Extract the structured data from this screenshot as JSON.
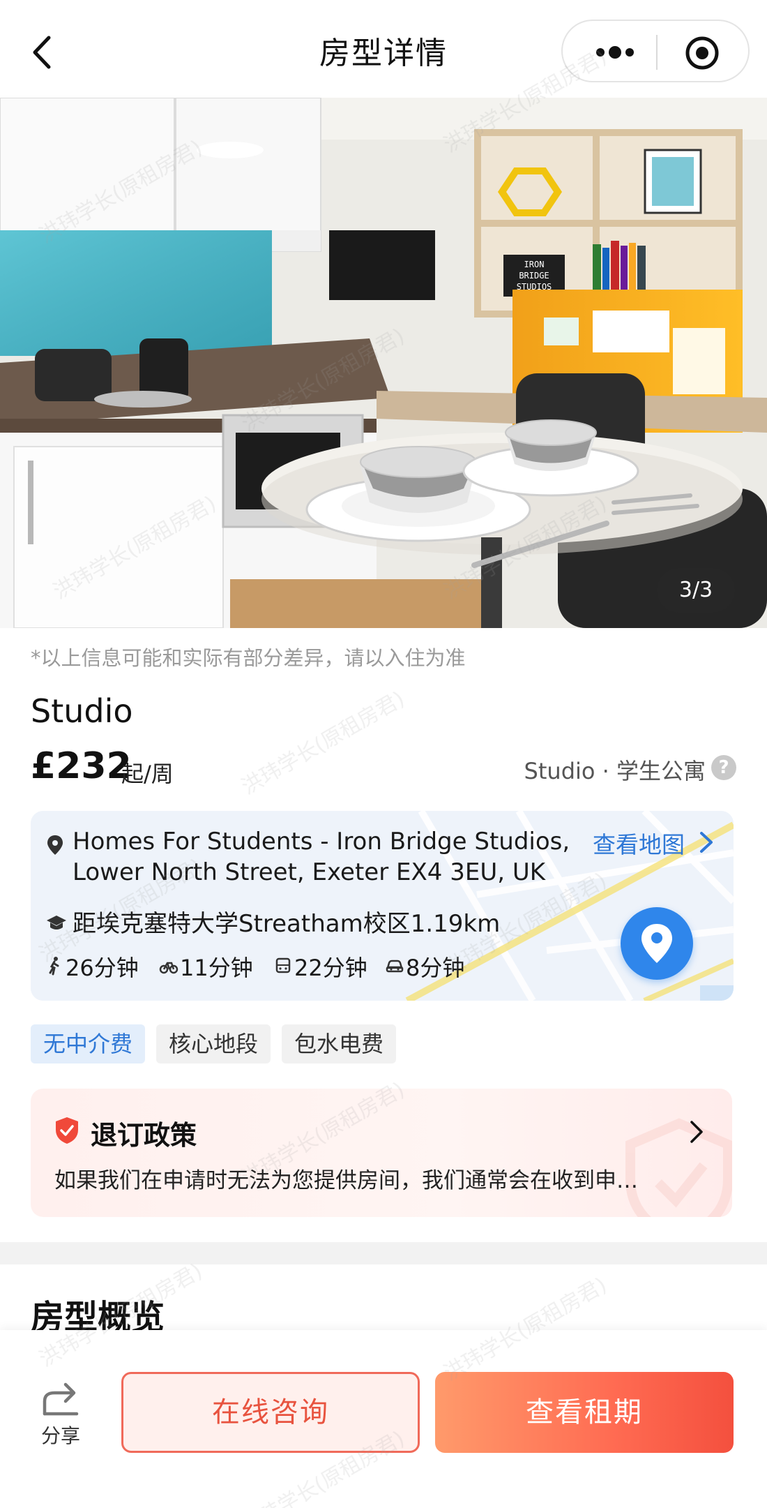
{
  "nav": {
    "title": "房型详情"
  },
  "hero": {
    "counter": "3/3",
    "sign_text": [
      "IRON",
      "BRIDGE",
      "STUDIOS"
    ]
  },
  "info": {
    "disclaimer": "*以上信息可能和实际有部分差异，请以入住为准",
    "room_name": "Studio",
    "price": "£232",
    "price_unit": "起/周",
    "room_type": "Studio · 学生公寓",
    "help_icon": "?"
  },
  "location": {
    "address": "Homes For Students - Iron Bridge Studios, Lower North Street, Exeter EX4 3EU, UK",
    "view_map_label": "查看地图",
    "distance": "距埃克塞特大学Streatham校区1.19km",
    "walk": "26分钟",
    "bike": "11分钟",
    "bus": "22分钟",
    "car": "8分钟"
  },
  "tags": [
    "无中介费",
    "核心地段",
    "包水电费"
  ],
  "policy": {
    "title": "退订政策",
    "description": "如果我们在申请时无法为您提供房间，我们通常会在收到申…"
  },
  "overview": {
    "title": "房型概览"
  },
  "bottom_bar": {
    "share_label": "分享",
    "consult_label": "在线咨询",
    "lease_label": "查看租期"
  },
  "watermark_text": "洪玮学长(原租房君)",
  "colors": {
    "accent_blue": "#2f78d6",
    "accent_red": "#f06a5a",
    "lease_gradient": [
      "#ff9a6b",
      "#f4503e"
    ]
  }
}
